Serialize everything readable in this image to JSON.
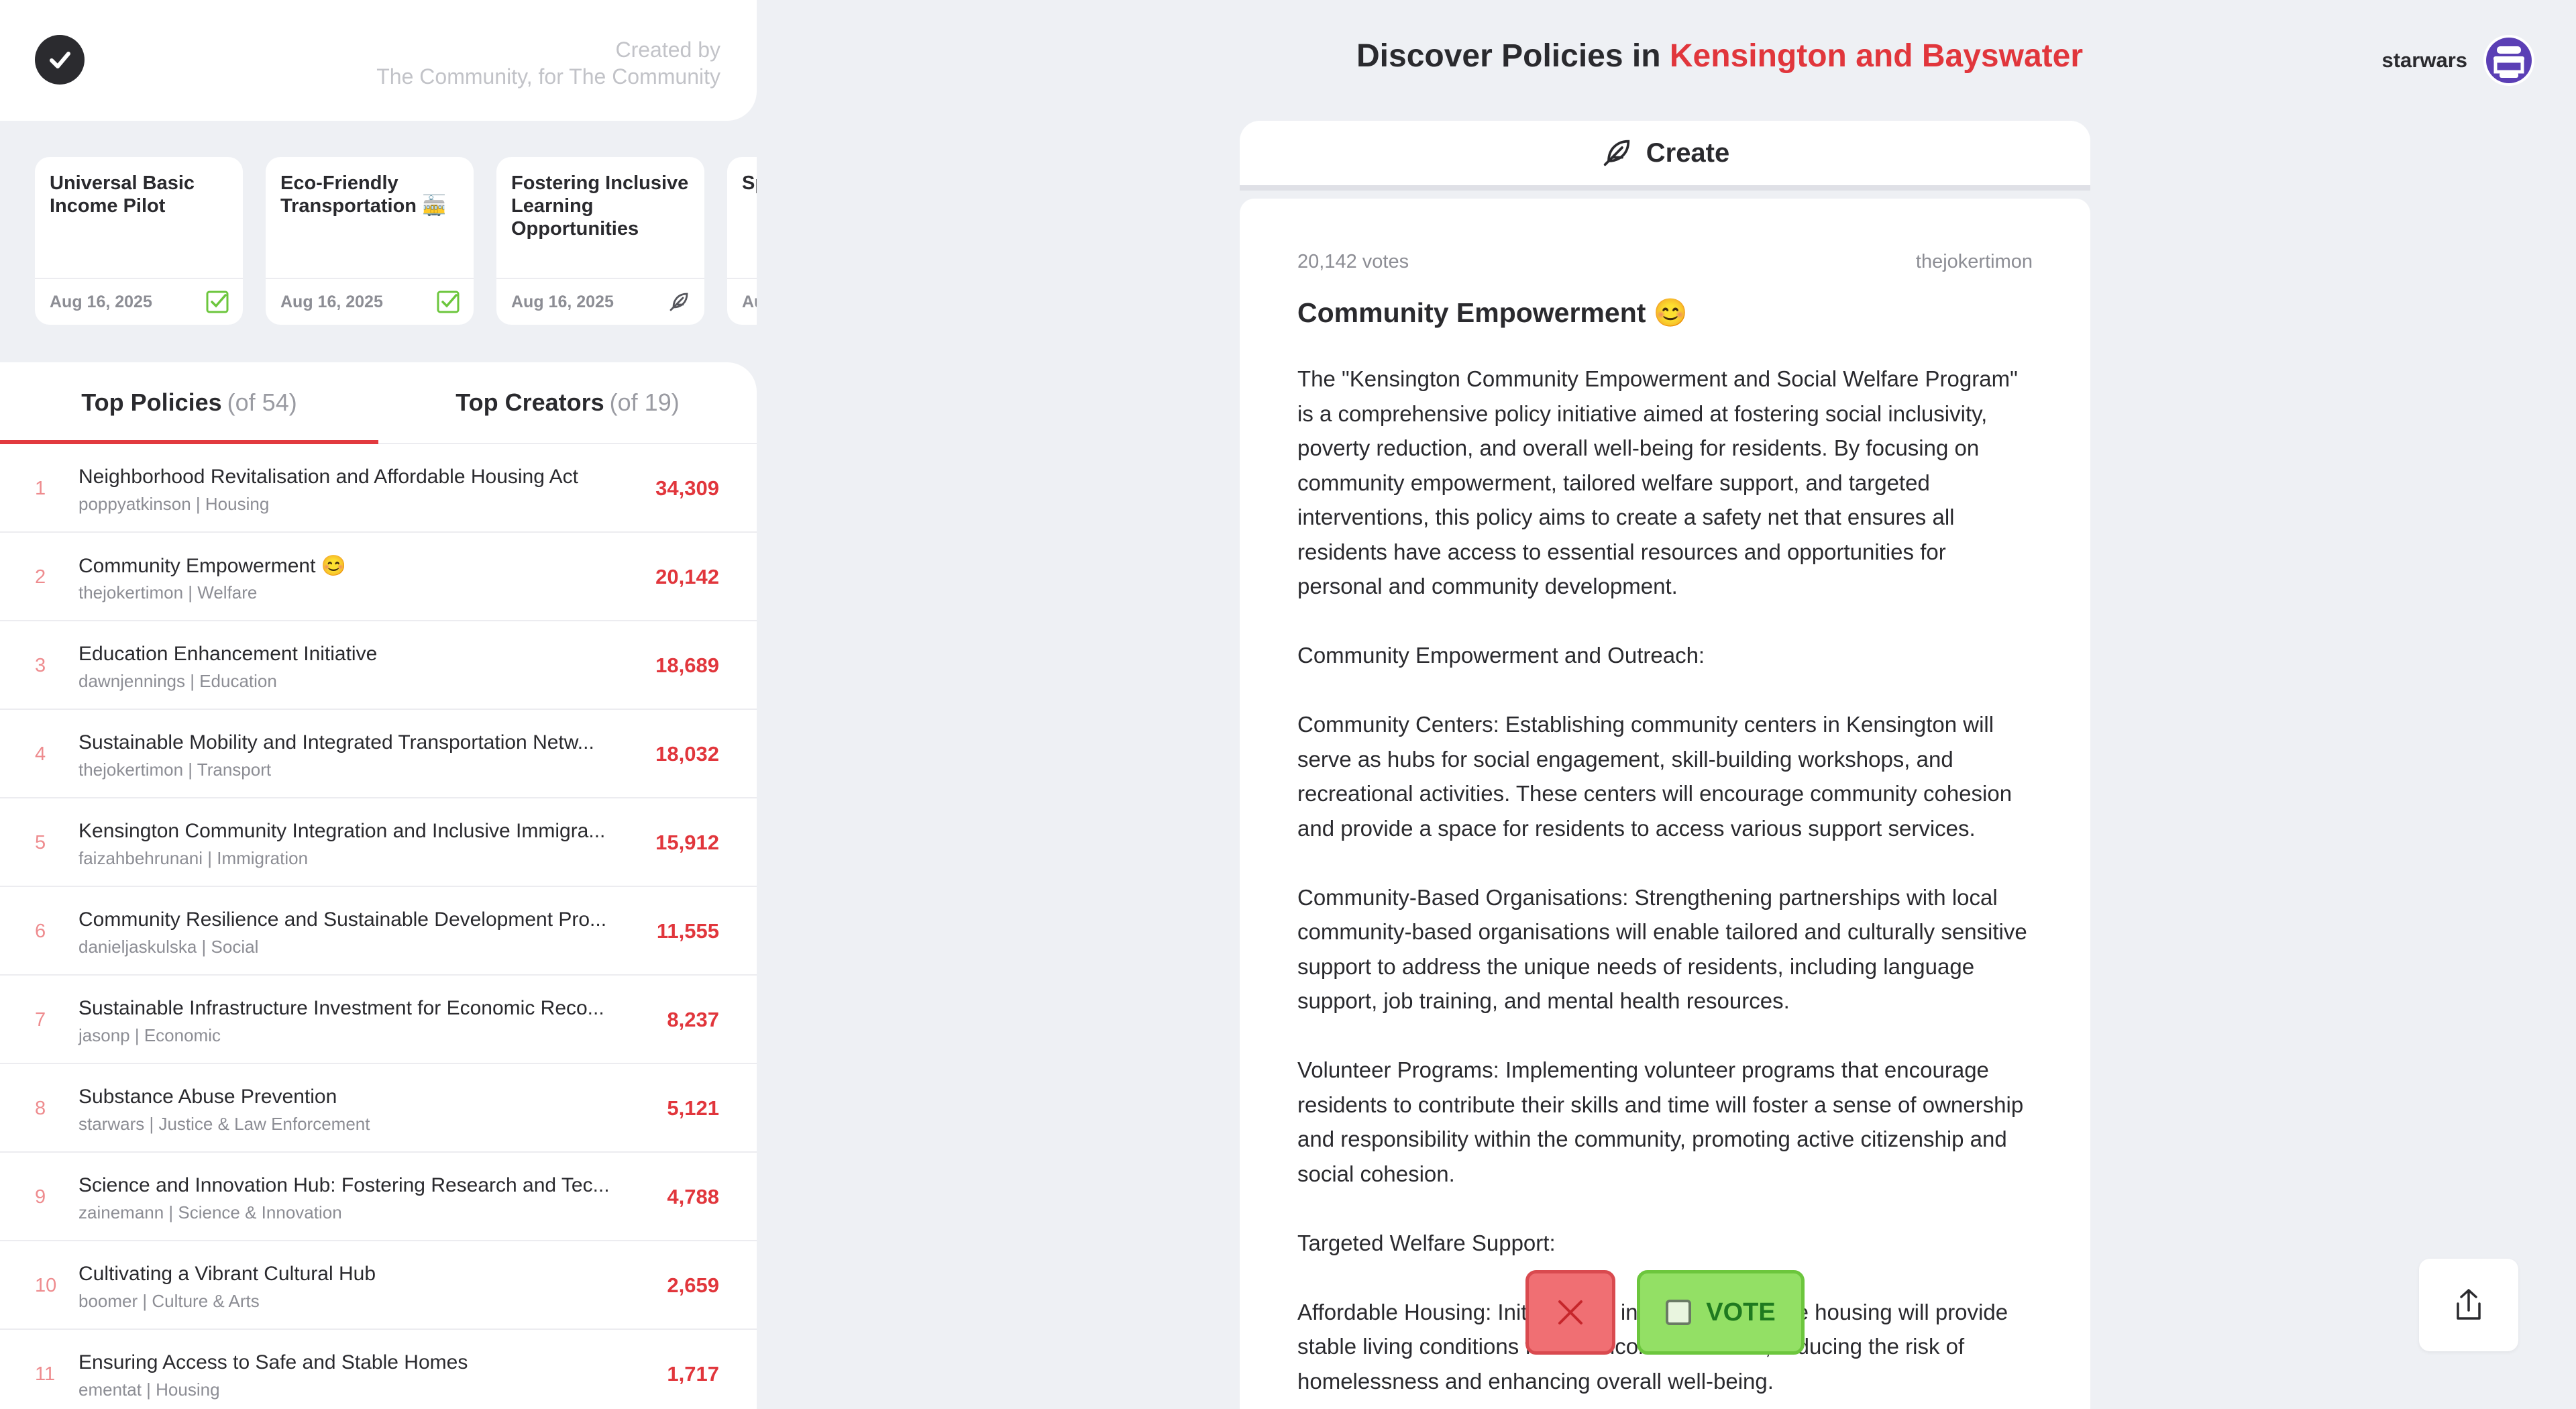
{
  "brand": {
    "created_line1": "Created by",
    "created_line2": "The Community, for The Community"
  },
  "carousel": [
    {
      "title": "Universal Basic Income Pilot",
      "date": "Aug 16, 2025",
      "icon": "check-square-icon"
    },
    {
      "title": "Eco-Friendly Transportation 🚋",
      "date": "Aug 16, 2025",
      "icon": "check-square-icon"
    },
    {
      "title": "Fostering Inclusive Learning Opportunities",
      "date": "Aug 16, 2025",
      "icon": "feather-icon"
    },
    {
      "title": "Sp... Po...",
      "date": "Au...",
      "icon": ""
    }
  ],
  "tabs": {
    "policies": "Top Policies",
    "policies_count": "(of 54)",
    "creators": "Top Creators",
    "creators_count": "(of 19)"
  },
  "leaderboard": [
    {
      "rank": "1",
      "title": "Neighborhood Revitalisation and Affordable Housing Act",
      "sub": "poppyatkinson | Housing",
      "votes": "34,309"
    },
    {
      "rank": "2",
      "title": "Community Empowerment 😊",
      "sub": "thejokertimon | Welfare",
      "votes": "20,142"
    },
    {
      "rank": "3",
      "title": "Education Enhancement Initiative",
      "sub": "dawnjennings | Education",
      "votes": "18,689"
    },
    {
      "rank": "4",
      "title": "Sustainable Mobility and Integrated Transportation Netw...",
      "sub": "thejokertimon | Transport",
      "votes": "18,032"
    },
    {
      "rank": "5",
      "title": "Kensington Community Integration and Inclusive Immigra...",
      "sub": "faizahbehrunani | Immigration",
      "votes": "15,912"
    },
    {
      "rank": "6",
      "title": "Community Resilience and Sustainable Development Pro...",
      "sub": "danieljaskulska | Social",
      "votes": "11,555"
    },
    {
      "rank": "7",
      "title": "Sustainable Infrastructure Investment for Economic Reco...",
      "sub": "jasonp | Economic",
      "votes": "8,237"
    },
    {
      "rank": "8",
      "title": "Substance Abuse Prevention",
      "sub": "starwars | Justice & Law Enforcement",
      "votes": "5,121"
    },
    {
      "rank": "9",
      "title": "Science and Innovation Hub: Fostering Research and Tec...",
      "sub": "zainemann | Science & Innovation",
      "votes": "4,788"
    },
    {
      "rank": "10",
      "title": "Cultivating a Vibrant Cultural Hub",
      "sub": "boomer | Culture & Arts",
      "votes": "2,659"
    },
    {
      "rank": "11",
      "title": "Ensuring Access to Safe and Stable Homes",
      "sub": "ementat | Housing",
      "votes": "1,717"
    }
  ],
  "header": {
    "title_prefix": "Discover Policies in",
    "region": "Kensington and Bayswater",
    "username": "starwars"
  },
  "create": {
    "label": "Create"
  },
  "post": {
    "votes": "20,142 votes",
    "author": "thejokertimon",
    "title": "Community Empowerment 😊",
    "paragraphs": [
      "The \"Kensington Community Empowerment and Social Welfare Program\" is a comprehensive policy initiative aimed at fostering social inclusivity, poverty reduction, and overall well-being for residents. By focusing on community empowerment, tailored welfare support, and targeted interventions, this policy aims to create a safety net that ensures all residents have access to essential resources and opportunities for personal and community development.",
      "Community Empowerment and Outreach:",
      "Community Centers: Establishing community centers in Kensington will serve as hubs for social engagement, skill-building workshops, and recreational activities. These centers will encourage community cohesion and provide a space for residents to access various support services.",
      "Community-Based Organisations: Strengthening partnerships with local community-based organisations will enable tailored and culturally sensitive support to address the unique needs of residents, including language support, job training, and mental health resources.",
      "Volunteer Programs: Implementing volunteer programs that encourage residents to contribute their skills and time will foster a sense of ownership and responsibility within the community, promoting active citizenship and social cohesion.",
      "Targeted Welfare Support:",
      "Affordable Housing: Initiatives to increase affordable housing will provide stable living conditions for low-income residents, reducing the risk of homelessness and enhancing overall well-being."
    ]
  },
  "actions": {
    "vote_label": "VOTE"
  },
  "colors": {
    "accent_red": "#e1363c",
    "vote_green": "#93e065",
    "reject_red": "#f06f73",
    "avatar_purple": "#5b3fb5"
  }
}
